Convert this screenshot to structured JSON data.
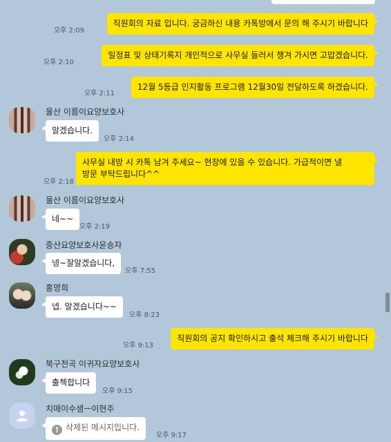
{
  "colors": {
    "background": "#b2c7da",
    "my_bubble": "#fee500",
    "their_bubble": "#ffffff"
  },
  "messages": [
    {
      "time": "오후 2:09",
      "text": "직원회의 자료 입니다. 궁금하신 내용 카톡방에서 문의 해 주시기 바랍니다"
    },
    {
      "time": "오후 2:10",
      "text": "일정표 및 상태기록지 개인적으로 사무실 들러서 챙겨 가시면 고맙겠습니다."
    },
    {
      "time": "오후 2:11",
      "text": "12월 5등급 인지활동 프로그램 12월30일 전달하도록 하겠습니다."
    },
    {
      "sender": "울산 이름이요양보호사",
      "time": "오후 2:14",
      "text": "알겠습니다."
    },
    {
      "time": "오후 2:18",
      "line1": "사무실 내방 시 카톡 남겨 주세요~ 현장에 있을 수 있습니다. 가급적이면 낼",
      "line2": "방문 부탁드립니다^^"
    },
    {
      "sender": "울산 이름이요양보호사",
      "time": "오후 2:19",
      "text": "네~~"
    },
    {
      "sender": "중산요양보호사윤송자",
      "time": "오후 7:55",
      "text": "넹~잘알겠습니다,"
    },
    {
      "sender": "홍영희",
      "time": "오후 8:23",
      "text": "넵.  알겠습니다~~"
    },
    {
      "time": "오후 9:13",
      "text": "직원회의 공지 확인하시고 출석 체크해 주시기 바랍니다"
    },
    {
      "sender": "북구천곡 이귀자요양보호사",
      "time": "오후 9:15",
      "text": "출첵합니다"
    },
    {
      "sender": "치매이수샘ㅡ이현주",
      "time": "오후 9:17",
      "text": "삭제된 메시지입니다.",
      "icon": "deleted-warning-icon"
    }
  ]
}
